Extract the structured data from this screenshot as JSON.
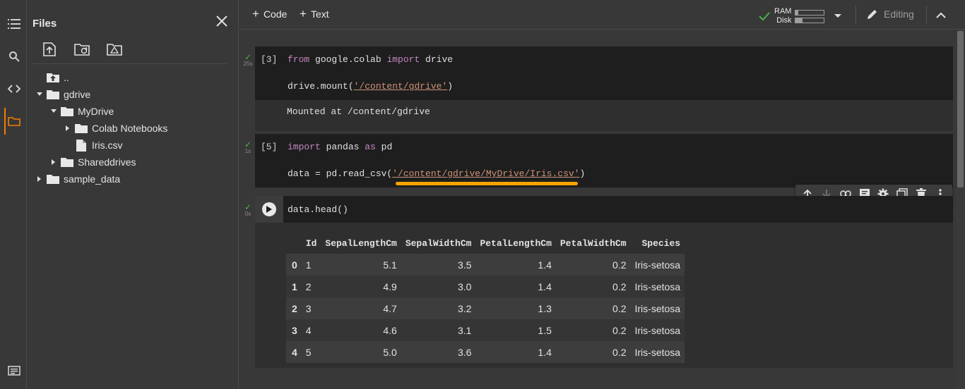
{
  "colors": {
    "accent": "#f57c00",
    "ok": "#4caf50",
    "keyword": "#c586c0",
    "string": "#ce9178",
    "highlight": "#f7a400"
  },
  "files": {
    "title": "Files",
    "tree": [
      {
        "label": "..",
        "icon": "folder-up-icon"
      },
      {
        "label": "gdrive",
        "icon": "folder-icon"
      },
      {
        "label": "MyDrive",
        "icon": "folder-icon"
      },
      {
        "label": "Colab Notebooks",
        "icon": "folder-icon"
      },
      {
        "label": "Iris.csv",
        "icon": "file-icon"
      },
      {
        "label": "Shareddrives",
        "icon": "folder-icon"
      },
      {
        "label": "sample_data",
        "icon": "folder-icon"
      }
    ]
  },
  "toolbar": {
    "add_code": "Code",
    "add_text": "Text",
    "ram_label": "RAM",
    "disk_label": "Disk",
    "ram_usage": 0.08,
    "disk_usage": 0.25,
    "editing_label": "Editing"
  },
  "cells": [
    {
      "exec": "[3]",
      "time": "25s",
      "code": {
        "l1": {
          "kw1": "from",
          "mod": " google.colab ",
          "kw2": "import",
          "rest": " drive"
        },
        "l2": {
          "pre": "drive.mount(",
          "str": "'/content/gdrive'",
          "post": ")"
        }
      },
      "output": "Mounted at /content/gdrive"
    },
    {
      "exec": "[5]",
      "time": "1s",
      "code": {
        "l1": {
          "kw1": "import",
          "mod": " pandas ",
          "kw2": "as",
          "rest": " pd"
        },
        "l2": {
          "pre": "data = pd.read_csv(",
          "str": "'/content/gdrive/MyDrive/Iris.csv'",
          "post": ")"
        }
      }
    },
    {
      "time": "0s",
      "code": "data.head()",
      "table": {
        "columns": [
          "",
          "Id",
          "SepalLengthCm",
          "SepalWidthCm",
          "PetalLengthCm",
          "PetalWidthCm",
          "Species"
        ],
        "rows": [
          [
            "0",
            "1",
            "5.1",
            "3.5",
            "1.4",
            "0.2",
            "Iris-setosa"
          ],
          [
            "1",
            "2",
            "4.9",
            "3.0",
            "1.4",
            "0.2",
            "Iris-setosa"
          ],
          [
            "2",
            "3",
            "4.7",
            "3.2",
            "1.3",
            "0.2",
            "Iris-setosa"
          ],
          [
            "3",
            "4",
            "4.6",
            "3.1",
            "1.5",
            "0.2",
            "Iris-setosa"
          ],
          [
            "4",
            "5",
            "5.0",
            "3.6",
            "1.4",
            "0.2",
            "Iris-setosa"
          ]
        ]
      }
    }
  ]
}
